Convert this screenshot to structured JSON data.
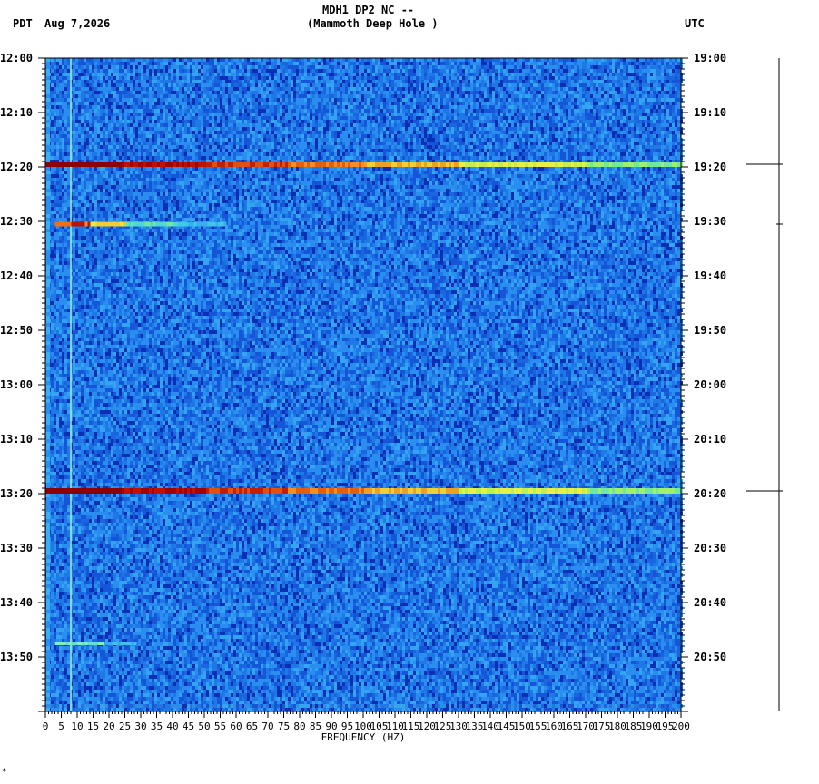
{
  "header": {
    "station": "MDH1 DP2 NC --",
    "location": "(Mammoth Deep Hole )",
    "left_tz": "PDT",
    "date": "Aug 7,2026",
    "right_tz": "UTC"
  },
  "corner_mark": "*",
  "chart_data": {
    "type": "heatmap",
    "xlabel": "FREQUENCY (HZ)",
    "xlim": [
      0,
      200
    ],
    "x_ticks": [
      "0",
      "5",
      "10",
      "15",
      "20",
      "25",
      "30",
      "35",
      "40",
      "45",
      "50",
      "55",
      "60",
      "65",
      "70",
      "75",
      "80",
      "85",
      "90",
      "95",
      "100",
      "105",
      "110",
      "115",
      "120",
      "125",
      "130",
      "135",
      "140",
      "145",
      "150",
      "155",
      "160",
      "165",
      "170",
      "175",
      "180",
      "185",
      "190",
      "195",
      "200"
    ],
    "y_range_minutes": [
      0,
      120
    ],
    "y_ticks_left": [
      "12:00",
      "12:10",
      "12:20",
      "12:30",
      "12:40",
      "12:50",
      "13:00",
      "13:10",
      "13:20",
      "13:30",
      "13:40",
      "13:50"
    ],
    "y_ticks_right": [
      "19:00",
      "19:10",
      "19:20",
      "19:30",
      "19:40",
      "19:50",
      "20:00",
      "20:10",
      "20:20",
      "20:30",
      "20:40",
      "20:50"
    ],
    "background_color": "#1e78e6",
    "colorscale": [
      "#0a2fb4",
      "#1e78e6",
      "#2fb8f0",
      "#5fe8b0",
      "#f0f040",
      "#f07010",
      "#8b0000"
    ],
    "events": [
      {
        "minute": 19.5,
        "freq_start": 0,
        "freq_end": 200,
        "intensity": "strong"
      },
      {
        "minute": 30.5,
        "freq_start": 3,
        "freq_end": 57,
        "intensity": "moderate"
      },
      {
        "minute": 79.5,
        "freq_start": 0,
        "freq_end": 200,
        "intensity": "strong"
      },
      {
        "minute": 107.5,
        "freq_start": 3,
        "freq_end": 28,
        "intensity": "weak"
      }
    ],
    "constant_line_freq": 8,
    "trace_marks_minutes": [
      19.5,
      30.5,
      79.5
    ]
  }
}
